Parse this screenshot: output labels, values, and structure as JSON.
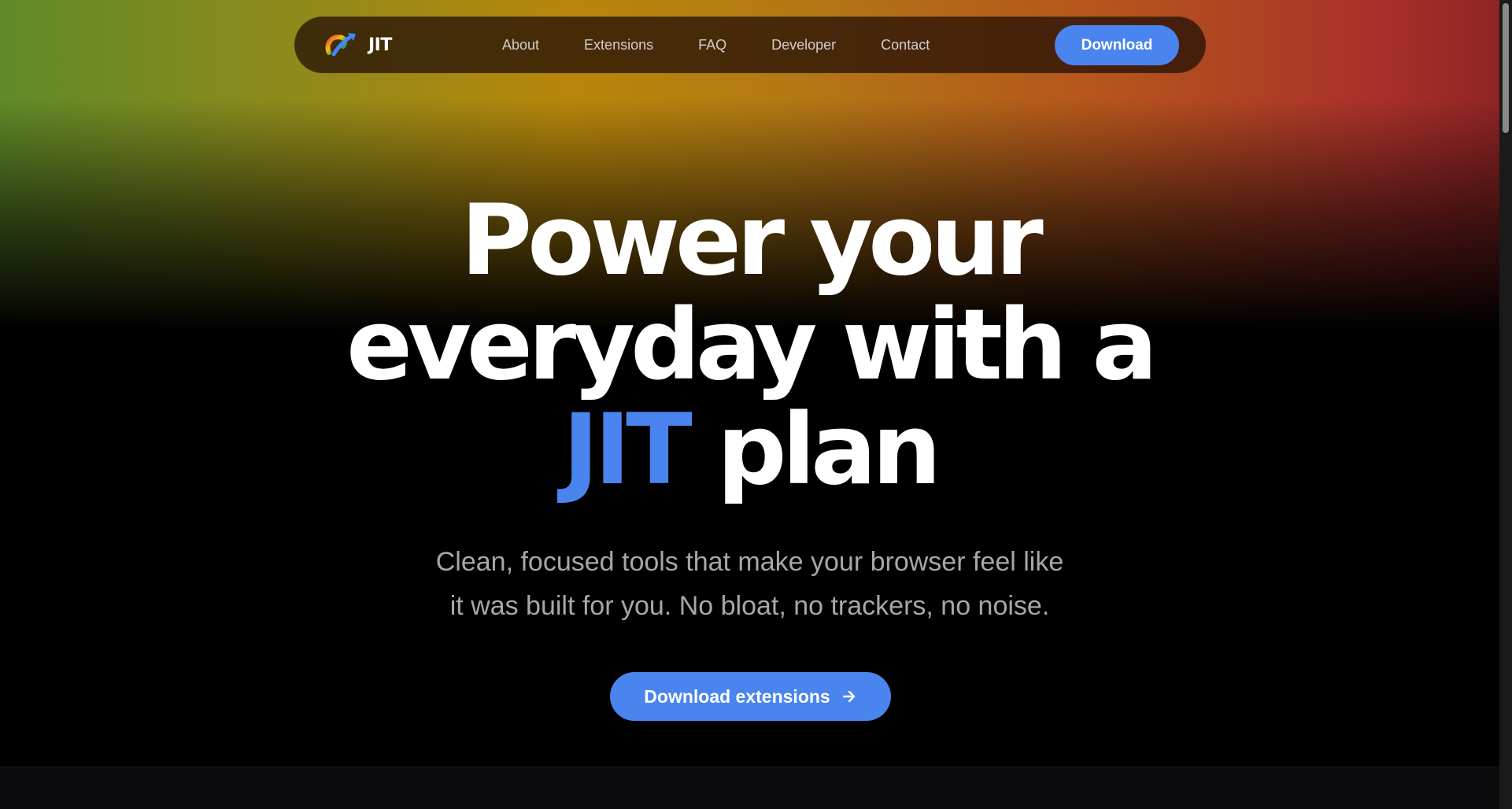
{
  "brand": {
    "name": "JIT",
    "logo_icon": "gradient-arrow-logo-icon"
  },
  "nav": {
    "links": [
      {
        "label": "About"
      },
      {
        "label": "Extensions"
      },
      {
        "label": "FAQ"
      },
      {
        "label": "Developer"
      },
      {
        "label": "Contact"
      }
    ],
    "download_label": "Download"
  },
  "hero": {
    "title_line1": "Power your",
    "title_line2": "everyday with a",
    "title_accent": "JIT",
    "title_line3_rest": "plan",
    "subtitle_line1": "Clean, focused tools that make your browser feel like",
    "subtitle_line2": "it was built for you. No bloat, no trackers, no noise.",
    "cta_label": "Download extensions",
    "cta_icon": "arrow-right-icon"
  },
  "colors": {
    "accent": "#4a84ee",
    "background": "#000000",
    "subtitle_text": "#a7a7a7",
    "nav_text": "#cfcfcf"
  }
}
